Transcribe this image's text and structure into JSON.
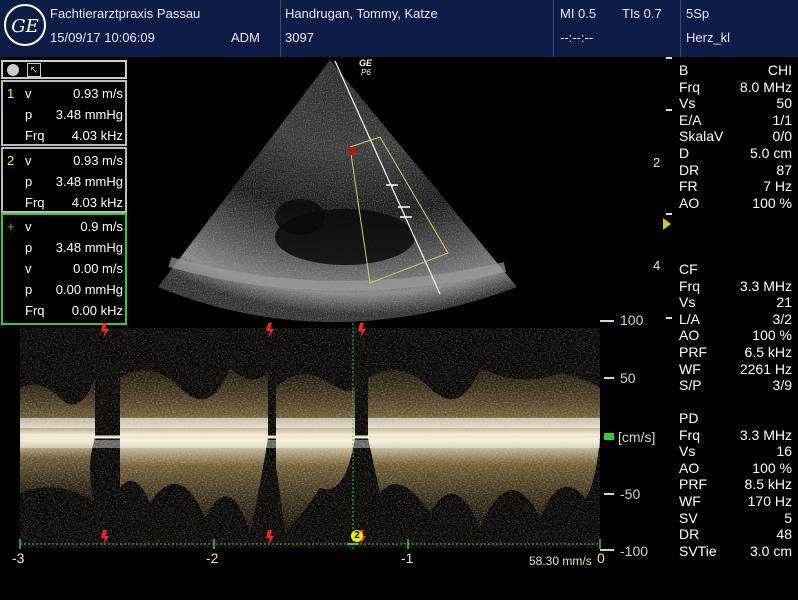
{
  "header": {
    "logo_text": "GE",
    "clinic": "Fachtierarztpraxis Passau",
    "datetime": "15/09/17 10:06:09",
    "operator": "ADM",
    "patient": "Handrugan, Tommy, Katze",
    "patient_id": "3097",
    "mi": "MI 0.5",
    "tis": "TIs 0.7",
    "probe": "5Sp",
    "preset": "Herz_kl",
    "placeholder": "--:--:--"
  },
  "measurements": {
    "group1": [
      {
        "idx": "1",
        "name": "v",
        "value": "0.93 m/s"
      },
      {
        "idx": "",
        "name": "p",
        "value": "3.48 mmHg"
      },
      {
        "idx": "",
        "name": "Frq",
        "value": "4.03 kHz"
      }
    ],
    "group2": [
      {
        "idx": "2",
        "name": "v",
        "value": "0.93 m/s"
      },
      {
        "idx": "",
        "name": "p",
        "value": "3.48 mmHg"
      },
      {
        "idx": "",
        "name": "Frq",
        "value": "4.03 kHz"
      }
    ],
    "group3": [
      {
        "idx": "+",
        "name": "v",
        "value": "0.9 m/s"
      },
      {
        "idx": "",
        "name": "p",
        "value": "3.48 mmHg"
      },
      {
        "idx": "",
        "name": "v",
        "value": "0.00 m/s"
      },
      {
        "idx": "",
        "name": "p",
        "value": "0.00 mmHg"
      },
      {
        "idx": "",
        "name": "Frq",
        "value": "0.00 kHz"
      }
    ]
  },
  "image": {
    "probe_brand": "GE",
    "probe_model": "P6",
    "depth_ticks": [
      "2",
      "4"
    ]
  },
  "spectrum": {
    "scale_labels": [
      "100",
      "50",
      "[cm/s]",
      "-50",
      "-100"
    ],
    "time_labels": [
      "-3",
      "-2",
      "-1",
      "0"
    ],
    "sweep_speed": "58.30 mm/s",
    "marker_label": "2"
  },
  "params": {
    "b_mode": [
      {
        "label": "B",
        "value": "CHI"
      },
      {
        "label": "Frq",
        "value": "8.0 MHz"
      },
      {
        "label": "Vs",
        "value": "50"
      },
      {
        "label": "E/A",
        "value": "1/1"
      },
      {
        "label": "SkalaV",
        "value": "0/0"
      },
      {
        "label": "D",
        "value": "5.0 cm"
      },
      {
        "label": "DR",
        "value": "87"
      },
      {
        "label": "FR",
        "value": "7 Hz"
      },
      {
        "label": "AO",
        "value": "100 %"
      }
    ],
    "cf_mode": [
      {
        "label": "CF",
        "value": ""
      },
      {
        "label": "Frq",
        "value": "3.3 MHz"
      },
      {
        "label": "Vs",
        "value": "21"
      },
      {
        "label": "L/A",
        "value": "3/2"
      },
      {
        "label": "AO",
        "value": "100 %"
      },
      {
        "label": "PRF",
        "value": "6.5 kHz"
      },
      {
        "label": "WF",
        "value": "2261 Hz"
      },
      {
        "label": "S/P",
        "value": "3/9"
      }
    ],
    "pd_mode": [
      {
        "label": "PD",
        "value": ""
      },
      {
        "label": "Frq",
        "value": "3.3 MHz"
      },
      {
        "label": "Vs",
        "value": "16"
      },
      {
        "label": "AO",
        "value": "100 %"
      },
      {
        "label": "PRF",
        "value": "8.5 kHz"
      },
      {
        "label": "WF",
        "value": "170 Hz"
      },
      {
        "label": "SV",
        "value": "5"
      },
      {
        "label": "DR",
        "value": "48"
      },
      {
        "label": "SVTie",
        "value": "3.0 cm"
      }
    ]
  },
  "colors": {
    "header_bg": "#0d1c44",
    "accent_yellow": "#ffff00",
    "measure_green": "#33cc33",
    "trigger_red": "#ff2020",
    "doppler_tan": "#d8c08a"
  }
}
